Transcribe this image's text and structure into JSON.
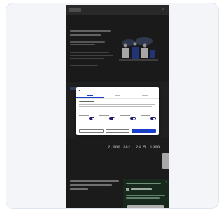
{
  "screen": {
    "description_free": true
  },
  "page": {
    "stats": [
      "2,000",
      "282",
      "24.5",
      "1900"
    ]
  },
  "consent": {
    "tabs": [
      "",
      "",
      ""
    ],
    "active_tab_index": 0,
    "toggles_on": [
      true,
      true,
      true,
      true
    ],
    "buttons": [
      "",
      "",
      ""
    ]
  },
  "promo": {
    "close_label": "×"
  },
  "colors": {
    "primary": "#1b3fc7",
    "promo_bg": "#1f3a26",
    "page_bg": "#2b2b2b"
  }
}
